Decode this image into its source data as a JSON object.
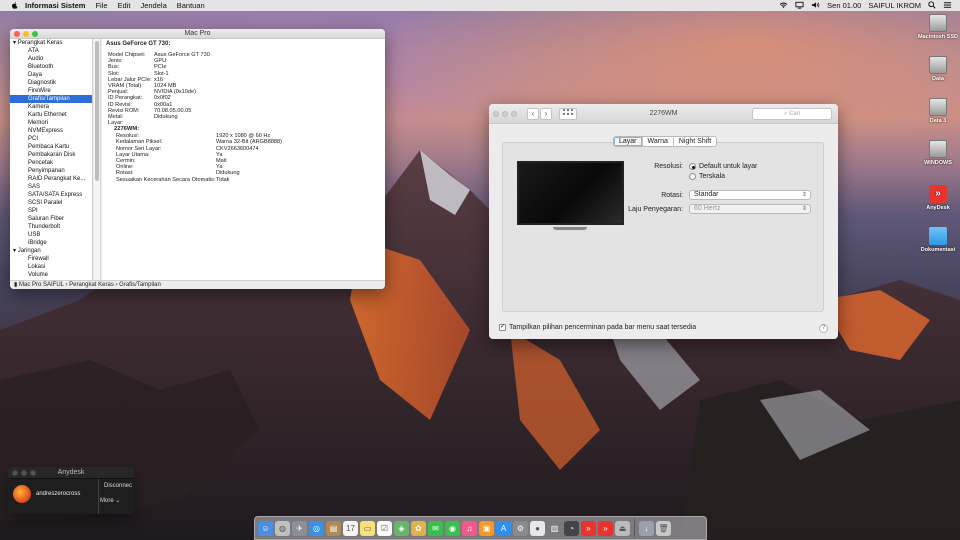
{
  "menubar": {
    "app_name": "Informasi Sistem",
    "items": [
      "File",
      "Edit",
      "Jendela",
      "Bantuan"
    ],
    "clock": "Sen 01.00",
    "user": "SAIFUL IKROM"
  },
  "desktop_icons": [
    {
      "label": "Macintosh SSD",
      "icon": "hard-disk-icon"
    },
    {
      "label": "Data",
      "icon": "hard-disk-icon"
    },
    {
      "label": "Data 3",
      "icon": "hard-disk-icon"
    },
    {
      "label": "WINDOWS",
      "icon": "hard-disk-icon"
    },
    {
      "label": "AnyDesk",
      "icon": "anydesk-icon"
    },
    {
      "label": "Dokumentasi",
      "icon": "folder-icon"
    }
  ],
  "sysinfo": {
    "title": "Mac Pro",
    "sidebar": [
      {
        "label": "Perangkat Keras",
        "group": true
      },
      {
        "label": "ATA"
      },
      {
        "label": "Audio"
      },
      {
        "label": "Bluetooth"
      },
      {
        "label": "Daya"
      },
      {
        "label": "Diagnostik"
      },
      {
        "label": "FireWire"
      },
      {
        "label": "Grafis/Tampilan",
        "selected": true
      },
      {
        "label": "Kamera"
      },
      {
        "label": "Kartu Ethernet"
      },
      {
        "label": "Memori"
      },
      {
        "label": "NVMExpress"
      },
      {
        "label": "PCI"
      },
      {
        "label": "Pembaca Kartu"
      },
      {
        "label": "Pembakaran Disk"
      },
      {
        "label": "Pencetak"
      },
      {
        "label": "Penyimpanan"
      },
      {
        "label": "RAID Perangkat Ke..."
      },
      {
        "label": "SAS"
      },
      {
        "label": "SATA/SATA Express"
      },
      {
        "label": "SCSI Paralel"
      },
      {
        "label": "SPI"
      },
      {
        "label": "Saluran Fiber"
      },
      {
        "label": "Thunderbolt"
      },
      {
        "label": "USB"
      },
      {
        "label": "iBridge"
      },
      {
        "label": "Jaringan",
        "group": true
      },
      {
        "label": "Firewall"
      },
      {
        "label": "Lokasi"
      },
      {
        "label": "Volume"
      }
    ],
    "header": "Asus GeForce GT 730:",
    "props": [
      [
        "Model Chipset:",
        "Asus GeForce GT 730"
      ],
      [
        "Jenis:",
        "GPU"
      ],
      [
        "Bus:",
        "PCIe"
      ],
      [
        "Slot:",
        "Slot-1"
      ],
      [
        "Lebar Jalur PCIe:",
        "x16"
      ],
      [
        "VRAM (Total):",
        "1024 MB"
      ],
      [
        "Penjual:",
        "NVIDIA (0x10de)"
      ],
      [
        "ID Perangkat:",
        "0x0f02"
      ],
      [
        "ID Revisi:",
        "0x00a1"
      ],
      [
        "Revisi ROM:",
        "70.08.05.00.05"
      ],
      [
        "Metal:",
        "Didukung"
      ]
    ],
    "layar_label": "Layar:",
    "display_name": "2276WM:",
    "display_props": [
      [
        "Resolusi:",
        "1920 x 1080 @ 60 Hz"
      ],
      [
        "Kedalaman Piksel:",
        "Warna 32-Bit (ARGB8888)"
      ],
      [
        "Nomor Seri Layar:",
        "CKV2663600474"
      ],
      [
        "Layar Utama:",
        "Ya"
      ],
      [
        "Cermin:",
        "Mati"
      ],
      [
        "Online:",
        "Ya"
      ],
      [
        "Rotasi:",
        "Didukung"
      ],
      [
        "Sesuaikan Kecerahan Secara Otomatis:",
        "Tidak"
      ]
    ],
    "path": [
      "Mac Pro SAIFUL",
      "Perangkat Keras",
      "Grafis/Tampilan"
    ]
  },
  "display": {
    "title": "2276WM",
    "search_placeholder": "Cari",
    "tabs": [
      "Layar",
      "Warna",
      "Night Shift"
    ],
    "active_tab": "Layar",
    "resolution_label": "Resolusi:",
    "resolution_options": [
      "Default untuk layar",
      "Terskala"
    ],
    "rotation_label": "Rotasi:",
    "rotation_value": "Standar",
    "refresh_label": "Laju Penyegaran:",
    "refresh_value": "60 Hertz",
    "mirror_label": "Tampilkan pilihan pencerminan pada bar menu saat tersedia"
  },
  "anydesk": {
    "title": "Anydesk",
    "user": "andreszerocross",
    "status": "Disconnec",
    "more": "More"
  },
  "dock_icons": [
    "finder-icon",
    "launchpad-icon",
    "rocket-icon",
    "safari-icon",
    "contacts-icon",
    "calendar-icon",
    "notes-icon",
    "reminders-icon",
    "maps-icon",
    "photos-icon",
    "messages-icon",
    "facetime-icon",
    "itunes-icon",
    "ibooks-icon",
    "appstore-icon",
    "preferences-icon",
    "chrome-icon",
    "sysinfo-icon",
    "activity-icon",
    "anydesk-icon",
    "anydesk2-icon",
    "ejector-icon",
    "downloads-icon",
    "trash-icon"
  ],
  "colors": {
    "accent": "#2d6fd6",
    "anydesk": "#e8342d"
  }
}
